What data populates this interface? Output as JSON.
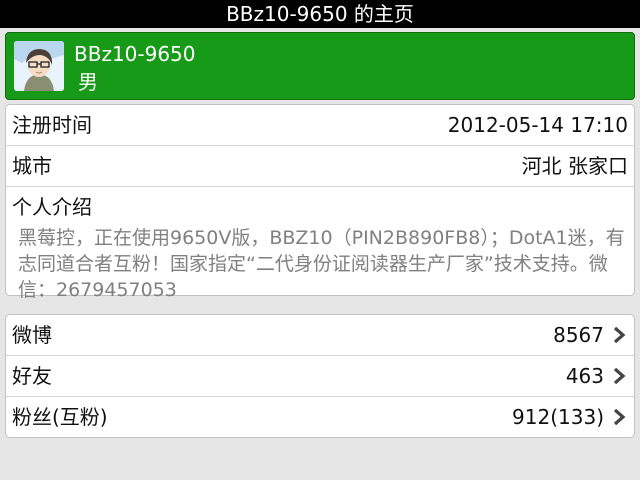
{
  "title": "BBz10-9650 的主页",
  "profile": {
    "name": "BBz10-9650",
    "gender": "男"
  },
  "info": {
    "register_label": "注册时间",
    "register_value": "2012-05-14 17:10",
    "city_label": "城市",
    "city_value": "河北 张家口",
    "intro_label": "个人介绍",
    "intro_text": "黑莓控，正在使用9650V版，BBZ10（PIN2B890FB8）；DotA1迷，有志同道合者互粉！国家指定“二代身份证阅读器生产厂家”技术支持。微信：2679457053"
  },
  "stats": {
    "weibo_label": "微博",
    "weibo_value": "8567",
    "friends_label": "好友",
    "friends_value": "463",
    "fans_label": "粉丝(互粉)",
    "fans_value": "912(133)"
  },
  "colors": {
    "header_bg": "#000000",
    "profile_green": "#179a17",
    "muted_text": "#808080"
  },
  "icons": {
    "avatar": "cartoon-avatar",
    "chevron": "chevron-right-icon"
  }
}
